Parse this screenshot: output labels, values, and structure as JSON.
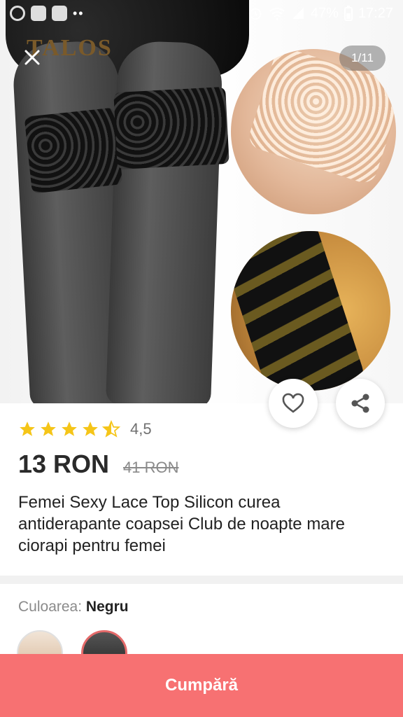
{
  "status_bar": {
    "battery": "47%",
    "time": "17:27"
  },
  "gallery": {
    "brand_watermark": "TALOS",
    "counter": "1/11"
  },
  "product": {
    "rating_value": "4,5",
    "rating_stars": 4.5,
    "price": "13 RON",
    "old_price": "41 RON",
    "title": "Femei Sexy Lace Top Silicon curea antiderapante coapsei Club de noapte mare ciorapi pentru femei"
  },
  "variant": {
    "label": "Culoarea:",
    "value": "Negru"
  },
  "actions": {
    "buy_label": "Cumpără"
  },
  "colors": {
    "accent": "#f77172",
    "star": "#f5c518"
  }
}
